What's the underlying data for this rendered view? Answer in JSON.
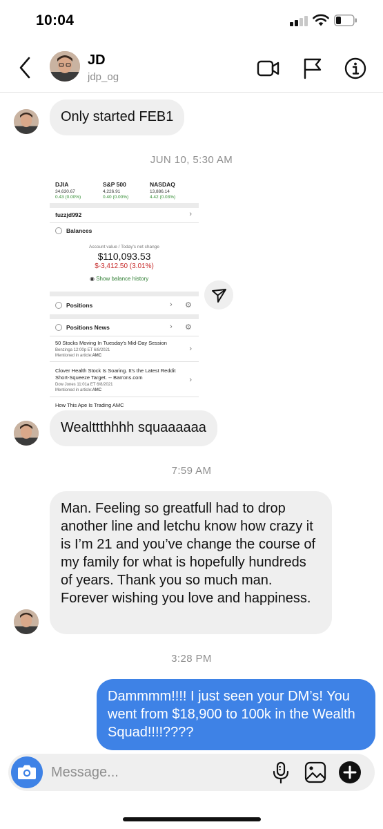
{
  "status_bar": {
    "time": "10:04"
  },
  "header": {
    "name": "JD",
    "username": "jdp_og"
  },
  "messages": [
    {
      "text": "Only started FEB1"
    },
    {
      "text": "Wealttthhhh squaaaaaa"
    },
    {
      "text": "Man. Feeling so greatfull had to drop another line and letchu know how crazy it is I’m 21 and you’ve change the course of my family for what is hopefully hundreds of years. Thank you so much man. Forever wishing you love and happiness."
    },
    {
      "text": "Dammmm!!!! I just seen your DM’s! You went from $18,900 to 100k in the Wealth Squad!!!!????"
    }
  ],
  "timestamps": [
    "JUN 10, 5:30 AM",
    "7:59 AM",
    "3:28 PM"
  ],
  "shared_screenshot": {
    "indices": [
      {
        "name": "DJIA",
        "value": "34,630.67",
        "change": "0.43 (0.00%)"
      },
      {
        "name": "S&P 500",
        "value": "4,226.91",
        "change": "0.40 (0.00%)"
      },
      {
        "name": "NASDAQ",
        "value": "13,886.14",
        "change": "4.42 (0.03%)"
      }
    ],
    "account": "fuzzjd992",
    "balances_label": "Balances",
    "account_value_label": "Account value / Today's net change",
    "account_value": "$110,093.53",
    "net_change": "$-3,412.50 (3.01%)",
    "history_link": "Show balance history",
    "positions_label": "Positions",
    "positions_news_label": "Positions News",
    "news": [
      {
        "title": "50 Stocks Moving In Tuesday's Mid-Day Session",
        "source": "Benzinga 12:00p ET 6/8/2021",
        "mentioned_prefix": "Mentioned in article:",
        "ticker": "AMC"
      },
      {
        "title": "Clover Health Stock Is Soaring. It's the Latest Reddit Short-Squeeze Target. -- Barrons.com",
        "source": "Dow Jones 11:01a ET 6/8/2021",
        "mentioned_prefix": "Mentioned in article:",
        "ticker": "AMC"
      },
      {
        "title": "How This Ape Is Trading AMC"
      }
    ]
  },
  "composer": {
    "placeholder": "Message..."
  },
  "colors": {
    "outgoing_bubble": "#3e82e6",
    "incoming_bubble": "#efefef",
    "camera_button": "#3e82e6"
  },
  "icons": [
    "back-chevron-icon",
    "video-call-icon",
    "flag-icon",
    "info-icon",
    "share-send-icon",
    "camera-icon",
    "microphone-icon",
    "gallery-icon",
    "plus-icon"
  ]
}
